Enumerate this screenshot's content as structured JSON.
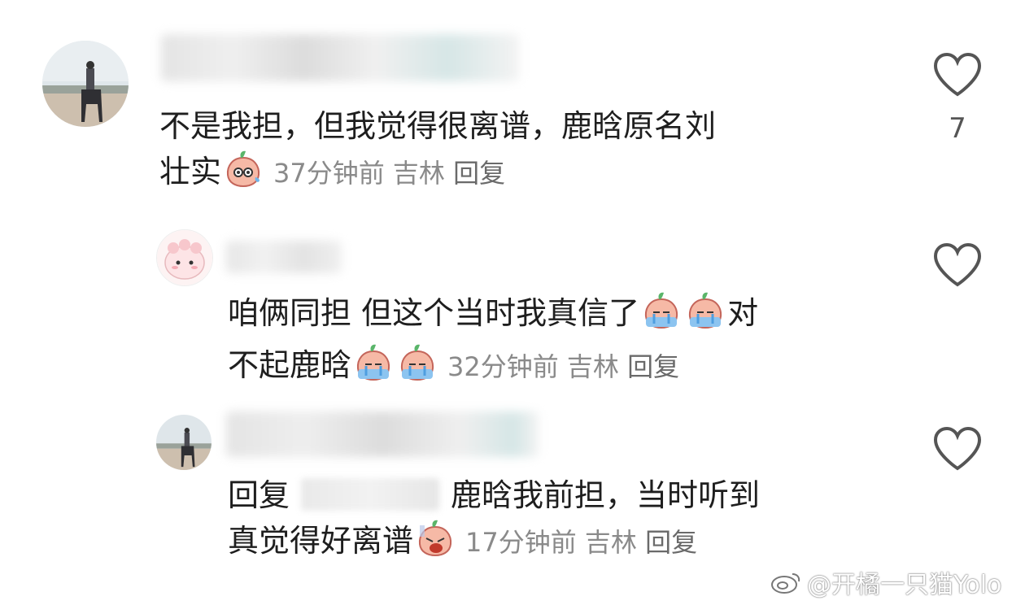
{
  "comments": [
    {
      "text_line1": "不是我担，但我觉得很离谱，鹿晗原名刘",
      "text_line2": "壮实",
      "time": "37分钟前",
      "location": "吉林",
      "reply_label": "回复",
      "likes": "7",
      "emoji": [
        "sweat-face-emoji"
      ]
    },
    {
      "text_line1": "咱俩同担 但这个当时我真信了",
      "text_line1_end": "对",
      "text_line2": "不起鹿晗",
      "time": "32分钟前",
      "location": "吉林",
      "reply_label": "回复",
      "emoji": [
        "crying-face-emoji",
        "crying-face-emoji",
        "crying-face-emoji",
        "crying-face-emoji"
      ]
    },
    {
      "reply_prefix": "回复",
      "text_line1": "鹿晗我前担，当时听到",
      "text_line2": "真觉得好离谱",
      "time": "17分钟前",
      "location": "吉林",
      "reply_label": "回复",
      "emoji": [
        "screaming-face-emoji"
      ]
    }
  ],
  "watermark": "@开橘一只猫Yolo",
  "colors": {
    "meta": "#8a8a8a",
    "heart_stroke": "#555555",
    "text": "#1e1e1e"
  }
}
